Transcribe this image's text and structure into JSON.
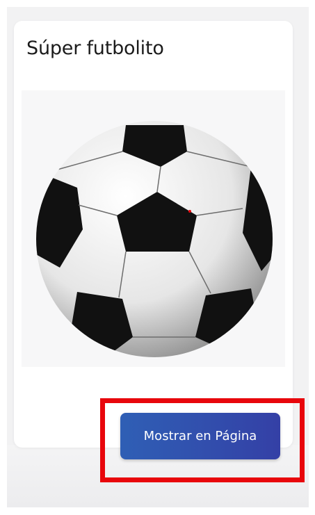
{
  "product": {
    "title": "Súper futbolito",
    "image_alt": "soccer-ball",
    "button_label": "Mostrar en Página"
  },
  "colors": {
    "button_start": "#2f5fb5",
    "button_end": "#3440a6",
    "highlight": "#e8060c"
  }
}
